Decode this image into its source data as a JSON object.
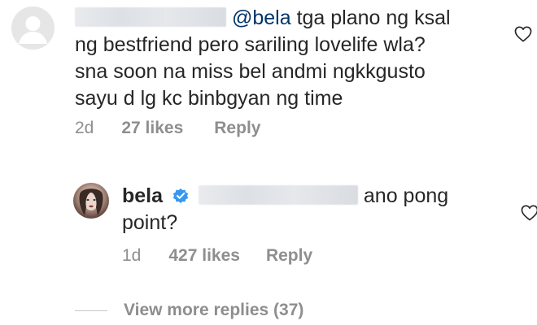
{
  "comment": {
    "mention": "@bela",
    "text_line1": "tga plano ng ksal",
    "text_line2": "ng bestfriend pero sariling lovelife wla?",
    "text_line3": "sna soon na miss bel andmi ngkkgusto",
    "text_line4": "sayu d lg kc binbgyan ng time",
    "time": "2d",
    "likes": "27 likes",
    "reply_label": "Reply"
  },
  "reply": {
    "username": "bela",
    "text_part1": "ano pong",
    "text_part2": "point?",
    "time": "1d",
    "likes": "427 likes",
    "reply_label": "Reply"
  },
  "view_more": {
    "label": "View more replies (37)"
  },
  "icons": {
    "comment_like": "heart-outline-icon",
    "reply_like": "heart-outline-icon",
    "verified": "verified-badge-icon",
    "default_avatar": "default-avatar-icon"
  },
  "colors": {
    "text": "#262626",
    "muted": "#8e8e8e",
    "mention": "#003569",
    "verified": "#3897f0"
  }
}
